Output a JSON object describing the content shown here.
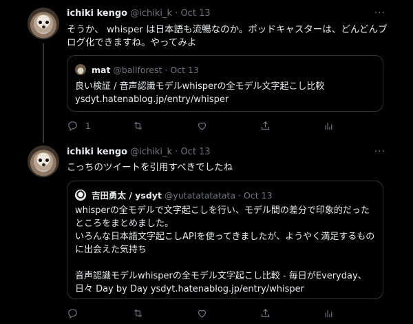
{
  "tweets": [
    {
      "name": "ichiki kengo",
      "handle": "@ichiki_k",
      "sep": "·",
      "date": "Oct 13",
      "more": "···",
      "text": "そうか、 whisper は日本語も流暢なのか。ポッドキャスターは、どんどんブログ化できますね。やってみよ",
      "quote": {
        "name": "mat",
        "handle": "@ballforest",
        "sep": "·",
        "date": "Oct 13",
        "text": "良い検証 / 音声認識モデルwhisperの全モデル文字起こし比較\nysdyt.hatenablog.jp/entry/whisper"
      },
      "reply_count": "1",
      "icons": [
        "reply-icon",
        "retweet-icon",
        "like-icon",
        "share-icon",
        "analytics-icon"
      ]
    },
    {
      "name": "ichiki kengo",
      "handle": "@ichiki_k",
      "sep": "·",
      "date": "Oct 13",
      "more": "···",
      "text": "こっちのツイートを引用すべきでしたね",
      "quote": {
        "name": "吉田勇太 / ysdyt",
        "handle": "@yutatatatatata",
        "sep": "·",
        "date": "Oct 13",
        "text": "whisperの全モデルで文字起こしを行い、モデル間の差分で印象的だったところをまとめました。\nいろんな日本語文字起こしAPIを使ってきましたが、ようやく満足するものに出会えた気持ち\n\n音声認識モデルwhisperの全モデル文字起こし比較 - 毎日がEveryday、日々 Day by Day ysdyt.hatenablog.jp/entry/whisper"
      },
      "reply_count": "",
      "icons": [
        "reply-icon",
        "retweet-icon",
        "like-icon",
        "share-icon",
        "analytics-icon"
      ]
    }
  ],
  "colors": {
    "background": "#000000",
    "text": "#e7e9ea",
    "muted": "#71767b",
    "border": "#2f3336"
  }
}
